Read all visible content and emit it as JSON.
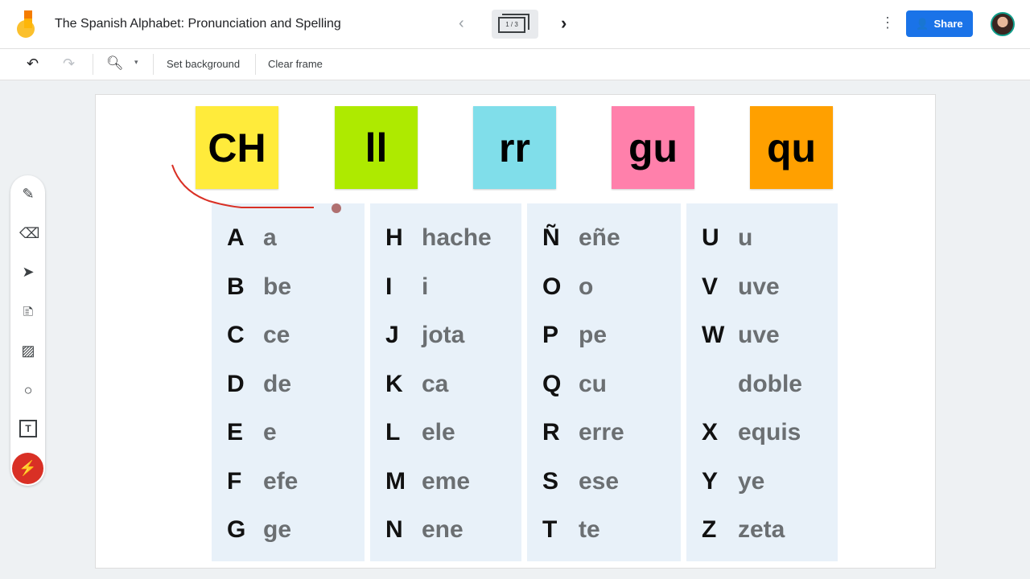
{
  "header": {
    "title": "The Spanish Alphabet: Pronunciation and Spelling",
    "frame_indicator": "1 / 3",
    "share_label": "Share"
  },
  "toolbar": {
    "set_background": "Set background",
    "clear_frame": "Clear frame"
  },
  "side_tools": [
    "pen-icon",
    "eraser-icon",
    "select-icon",
    "sticky-note-icon",
    "image-icon",
    "circle-icon",
    "text-box-icon",
    "laser-icon"
  ],
  "sticky_notes": [
    {
      "text": "CH",
      "color": "#ffeb3b"
    },
    {
      "text": "ll",
      "color": "#aeea00"
    },
    {
      "text": "rr",
      "color": "#80deea"
    },
    {
      "text": "gu",
      "color": "#ff80ab"
    },
    {
      "text": "qu",
      "color": "#ffa000"
    }
  ],
  "columns": [
    [
      [
        "A",
        "a"
      ],
      [
        "B",
        "be"
      ],
      [
        "C",
        "ce"
      ],
      [
        "D",
        "de"
      ],
      [
        "E",
        "e"
      ],
      [
        "F",
        "efe"
      ],
      [
        "G",
        "ge"
      ]
    ],
    [
      [
        "H",
        "hache"
      ],
      [
        "I",
        "i"
      ],
      [
        "J",
        "jota"
      ],
      [
        "K",
        "ca"
      ],
      [
        "L",
        "ele"
      ],
      [
        "M",
        "eme"
      ],
      [
        "N",
        "ene"
      ]
    ],
    [
      [
        "Ñ",
        "eñe"
      ],
      [
        "O",
        "o"
      ],
      [
        "P",
        "pe"
      ],
      [
        "Q",
        "cu"
      ],
      [
        "R",
        "erre"
      ],
      [
        "S",
        "ese"
      ],
      [
        "T",
        "te"
      ]
    ],
    [
      [
        "U",
        "u"
      ],
      [
        "V",
        "uve"
      ],
      [
        "W",
        "uve"
      ],
      [
        "",
        "doble"
      ],
      [
        "X",
        "equis"
      ],
      [
        "Y",
        "ye"
      ],
      [
        "Z",
        "zeta"
      ]
    ]
  ],
  "colors": {
    "accent": "#1a73e8",
    "column_bg": "#e8f1f9",
    "ink": "#d93025"
  }
}
